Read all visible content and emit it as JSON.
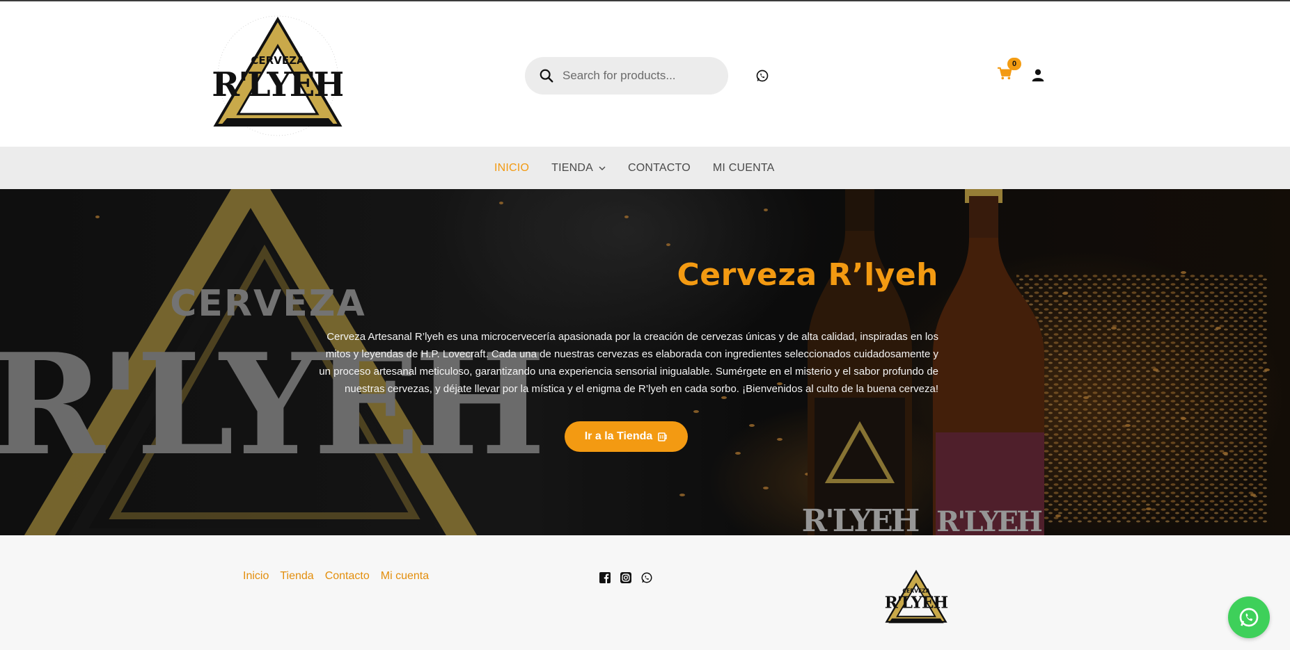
{
  "header": {
    "logo_alt": "Cerveza R'lyeh",
    "logo_top_word": "CERVEZA",
    "logo_main_word": "R'LYEH",
    "search": {
      "placeholder": "Search for products..."
    },
    "cart": {
      "count": "0"
    },
    "icons": [
      "search-icon",
      "whatsapp-icon",
      "cart-icon",
      "account-icon"
    ]
  },
  "nav": {
    "items": [
      {
        "label": "INICIO",
        "active": true
      },
      {
        "label": "TIENDA",
        "has_submenu": true
      },
      {
        "label": "CONTACTO"
      },
      {
        "label": "MI CUENTA"
      }
    ]
  },
  "hero": {
    "title": "Cerveza R’lyeh",
    "description": "Cerveza Artesanal R’lyeh es una microcervecería apasionada por la creación de cervezas únicas y de alta calidad, inspiradas en los mitos y leyendas de H.P. Lovecraft. Cada una de nuestras cervezas es elaborada con ingredientes seleccionados cuidadosamente y un proceso artesanal meticuloso, garantizando una experiencia sensorial inigualable. Sumérgete en el misterio y el sabor profundo de nuestras cervezas, y déjate llevar por la mística y el enigma de R’lyeh en cada sorbo. ¡Bienvenidos al culto de la buena cerveza!",
    "cta_label": "Ir a la Tienda",
    "bg_logo_top": "CERVEZA",
    "bg_logo_main": "R'LYEH",
    "bottle_label_1": "R'LYEH",
    "bottle_label_2": "R'LYEH"
  },
  "footer": {
    "links": [
      "Inicio",
      "Tienda",
      "Contacto",
      "Mi cuenta"
    ],
    "social": [
      "facebook-icon",
      "instagram-icon",
      "whatsapp-icon"
    ]
  },
  "colors": {
    "accent": "#f39a12",
    "nav_bg": "#ececec",
    "footer_bg": "#f7f7f7",
    "whatsapp": "#3ed05a"
  }
}
